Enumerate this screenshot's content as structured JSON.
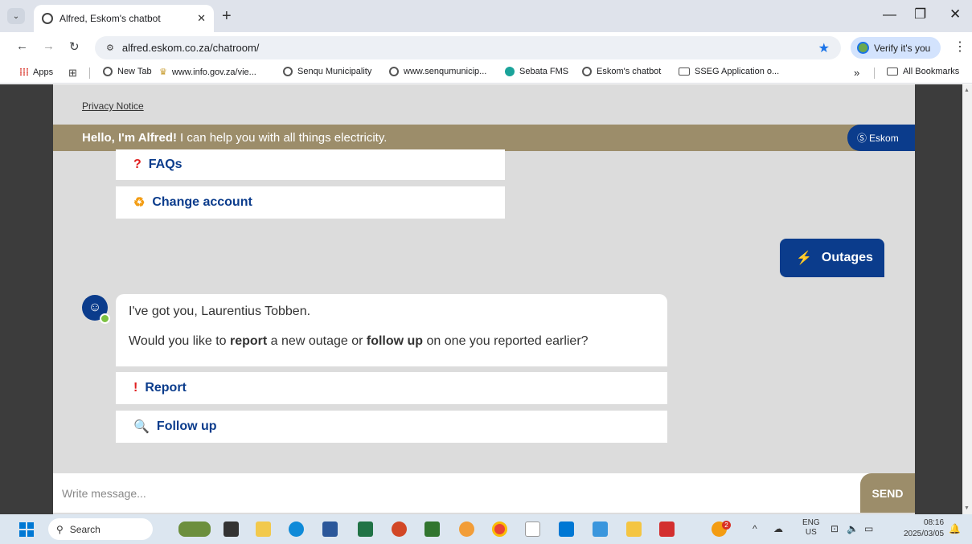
{
  "browser": {
    "tab_title": "Alfred, Eskom's chatbot",
    "tab_close": "✕",
    "new_tab": "+",
    "tab_menu": "⌄",
    "url": "alfred.eskom.co.za/chatroom/",
    "verify_label": "Verify it's you",
    "window_controls": {
      "minimize": "—",
      "maximize": "❐",
      "close": "✕"
    }
  },
  "bookmarks": [
    {
      "label": "Apps",
      "icon": "apps-grid-icon"
    },
    {
      "label": "",
      "icon": "tab-groups-icon"
    },
    {
      "label": "New Tab",
      "icon": "globe-icon"
    },
    {
      "label": "www.info.gov.za/vie...",
      "icon": "coat-of-arms-icon"
    },
    {
      "label": "Senqu Municipality",
      "icon": "globe-icon"
    },
    {
      "label": "www.senqumunicip...",
      "icon": "globe-icon"
    },
    {
      "label": "Sebata FMS",
      "icon": "sebata-icon"
    },
    {
      "label": "Eskom's chatbot",
      "icon": "globe-icon"
    },
    {
      "label": "SSEG Application o...",
      "icon": "folder-icon"
    },
    {
      "label": "All Bookmarks",
      "icon": "folder-icon"
    }
  ],
  "bookmarks_overflow": "»",
  "chat": {
    "privacy_notice": "Privacy Notice",
    "greeting_bold": "Hello, I'm Alfred!",
    "greeting_rest": "I can help you with all things electricity.",
    "brand": "Eskom",
    "options_top": [
      {
        "label": "FAQs",
        "icon": "question-mark-icon"
      },
      {
        "label": "Change account",
        "icon": "change-account-icon"
      }
    ],
    "user_message": "Outages",
    "bot_message_1": "I've got you, Laurentius Tobben.",
    "bot_message_2_parts": {
      "a": "Would you like to ",
      "b": "report",
      "c": " a new outage or ",
      "d": "follow up",
      "e": " on one you reported earlier?"
    },
    "options_bottom": [
      {
        "label": "Report",
        "icon": "exclamation-icon"
      },
      {
        "label": "Follow up",
        "icon": "magnifier-icon"
      }
    ],
    "composer_placeholder": "Write message...",
    "send_label": "SEND"
  },
  "taskbar": {
    "search_label": "Search",
    "notification_badge": "2",
    "lang_1": "ENG",
    "lang_2": "US",
    "time": "08:16",
    "date": "2025/03/05"
  },
  "colors": {
    "eskom_blue": "#0b3c8c",
    "alfred_gold": "#9c8d6a",
    "chat_bg": "#dcdcdc"
  }
}
